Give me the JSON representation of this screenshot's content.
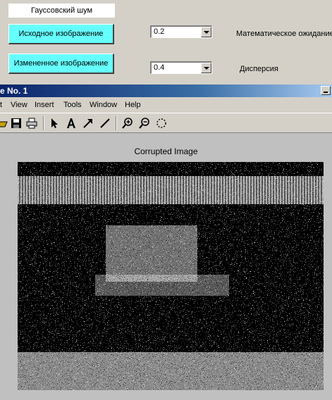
{
  "top_panel": {
    "noise_label": "Гауссовский шум",
    "original_button": "Исходное изображение",
    "modified_button": "Измененное изображение",
    "mean_select": "0.2",
    "variance_select": "0.4",
    "mean_label": "Математическое ожидание",
    "variance_label": "Дисперсия"
  },
  "figure_window": {
    "title": "e No. 1",
    "menu": [
      "t",
      "View",
      "Insert",
      "Tools",
      "Window",
      "Help"
    ],
    "toolbar_icons": [
      "open-icon",
      "save-icon",
      "print-icon",
      "arrow-icon",
      "text-icon",
      "line-arrow-icon",
      "line-icon",
      "zoom-in-icon",
      "zoom-out-icon",
      "rotate-icon"
    ],
    "plot_title": "Corrupted Image"
  },
  "colors": {
    "button_bg": "#66ffff",
    "panel_bg": "#d4d0c8",
    "figure_bg": "#c0c0c0",
    "titlebar": "#0a246a"
  }
}
